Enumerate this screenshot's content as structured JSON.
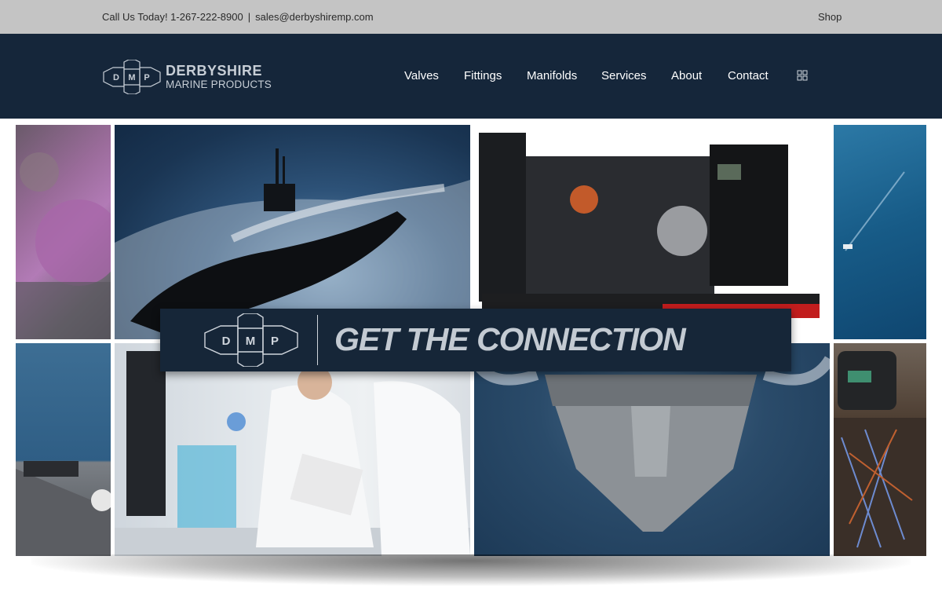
{
  "topbar": {
    "phone": "Call Us Today! 1-267-222-8900",
    "separator": "|",
    "email": "sales@derbyshiremp.com",
    "shop": "Shop"
  },
  "brand": {
    "name": "DERBYSHIRE",
    "sub": "MARINE PRODUCTS",
    "mark": [
      "D",
      "M",
      "P"
    ]
  },
  "nav": {
    "items": [
      {
        "label": "Valves"
      },
      {
        "label": "Fittings"
      },
      {
        "label": "Manifolds"
      },
      {
        "label": "Services"
      },
      {
        "label": "About"
      },
      {
        "label": "Contact"
      }
    ],
    "extra_icon": "grid-icon"
  },
  "banner": {
    "tagline": "GET THE CONNECTION"
  },
  "collage": {
    "tiles": [
      "engine-machinery-image",
      "submarine-image",
      "generator-image",
      "ocean-ship-image",
      "carrier-deck-image",
      "laboratory-image",
      "warship-image",
      "control-panel-image"
    ]
  },
  "colors": {
    "topbar": "#c4c4c4",
    "header": "#15263a",
    "banner": "#162638",
    "logo_text": "#c7ced6"
  }
}
